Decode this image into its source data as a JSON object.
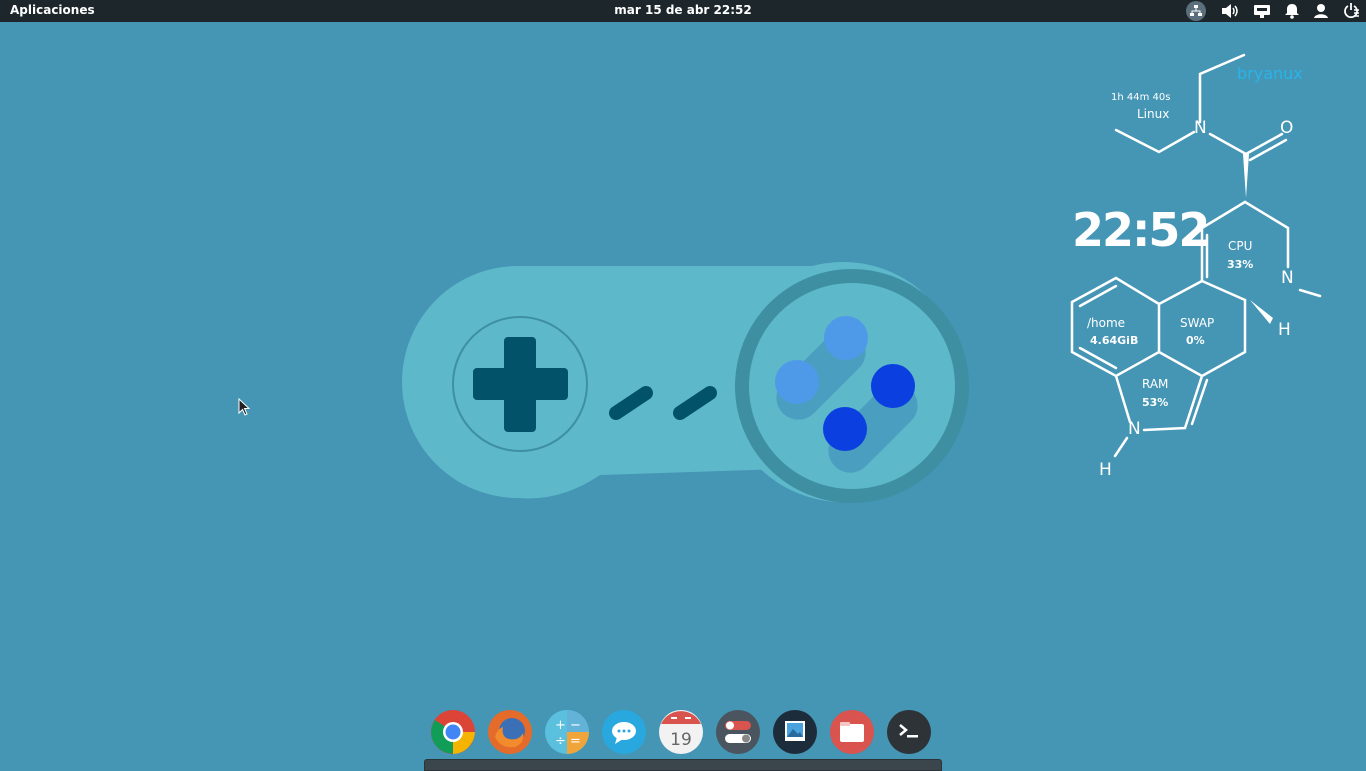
{
  "panel": {
    "applications_label": "Aplicaciones",
    "clock": "mar 15 de abr 22:52",
    "tray_icons": [
      "network-icon",
      "volume-icon",
      "display-icon",
      "notifications-icon",
      "user-icon",
      "power-icon"
    ]
  },
  "conky": {
    "username": "bryanux",
    "uptime": "1h 44m 40s",
    "os": "Linux",
    "time": "22:52",
    "cpu_label": "CPU",
    "cpu_value": "33%",
    "swap_label": "SWAP",
    "swap_value": "0%",
    "home_label": "/home",
    "home_value": "4.64GiB",
    "ram_label": "RAM",
    "ram_value": "53%",
    "atoms": {
      "n_top": "N",
      "o": "O",
      "n_right": "N",
      "h_right": "H",
      "n_bottom": "N",
      "h_bottom": "H"
    }
  },
  "dock": {
    "apps": [
      "chrome-icon",
      "firefox-icon",
      "calculator-icon",
      "chat-icon",
      "calendar-icon",
      "settings-icon",
      "photos-icon",
      "files-icon",
      "terminal-icon"
    ],
    "calendar_day": "19"
  },
  "colors": {
    "desktop": "#4595b5",
    "panel": "#1c262b",
    "accent": "#2ab4e8"
  }
}
